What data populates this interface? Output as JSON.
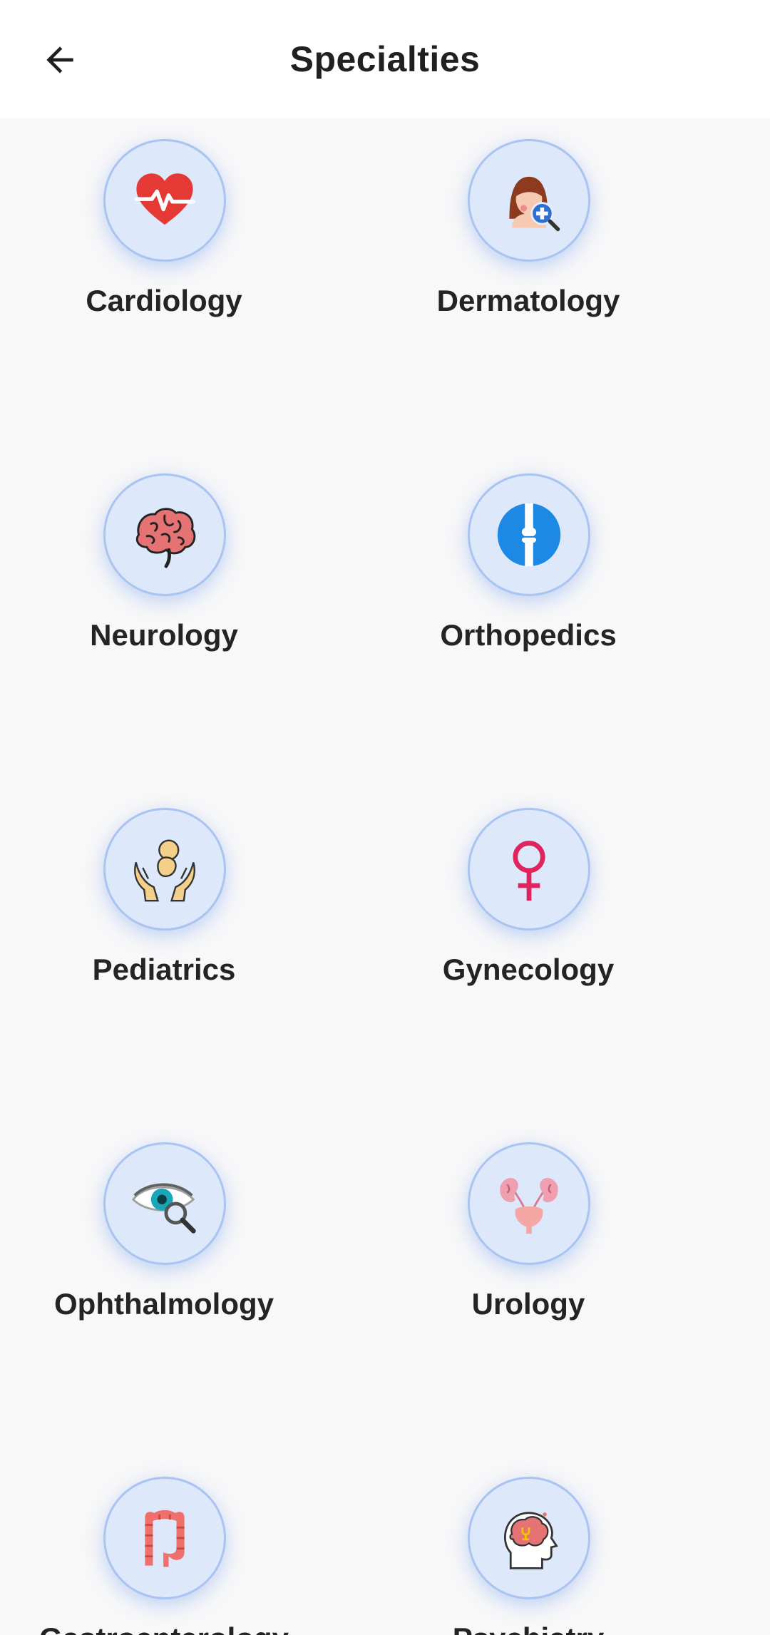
{
  "header": {
    "title": "Specialties",
    "back_icon": "arrow-left-icon"
  },
  "specialties": [
    {
      "label": "Cardiology",
      "icon": "heart-pulse-icon"
    },
    {
      "label": "Dermatology",
      "icon": "face-magnifier-icon"
    },
    {
      "label": "Neurology",
      "icon": "brain-icon"
    },
    {
      "label": "Orthopedics",
      "icon": "bone-joint-icon"
    },
    {
      "label": "Pediatrics",
      "icon": "baby-hands-icon"
    },
    {
      "label": "Gynecology",
      "icon": "female-symbol-icon"
    },
    {
      "label": "Ophthalmology",
      "icon": "eye-magnifier-icon"
    },
    {
      "label": "Urology",
      "icon": "kidneys-bladder-icon"
    },
    {
      "label": "Gastroenterology",
      "icon": "intestine-icon"
    },
    {
      "label": "Psychiatry",
      "icon": "head-brain-icon"
    }
  ],
  "colors": {
    "background": "#f8f8f9",
    "header_bg": "#ffffff",
    "circle_fill": "#dde8fb",
    "circle_border": "#a9c4f1",
    "text": "#242424"
  }
}
